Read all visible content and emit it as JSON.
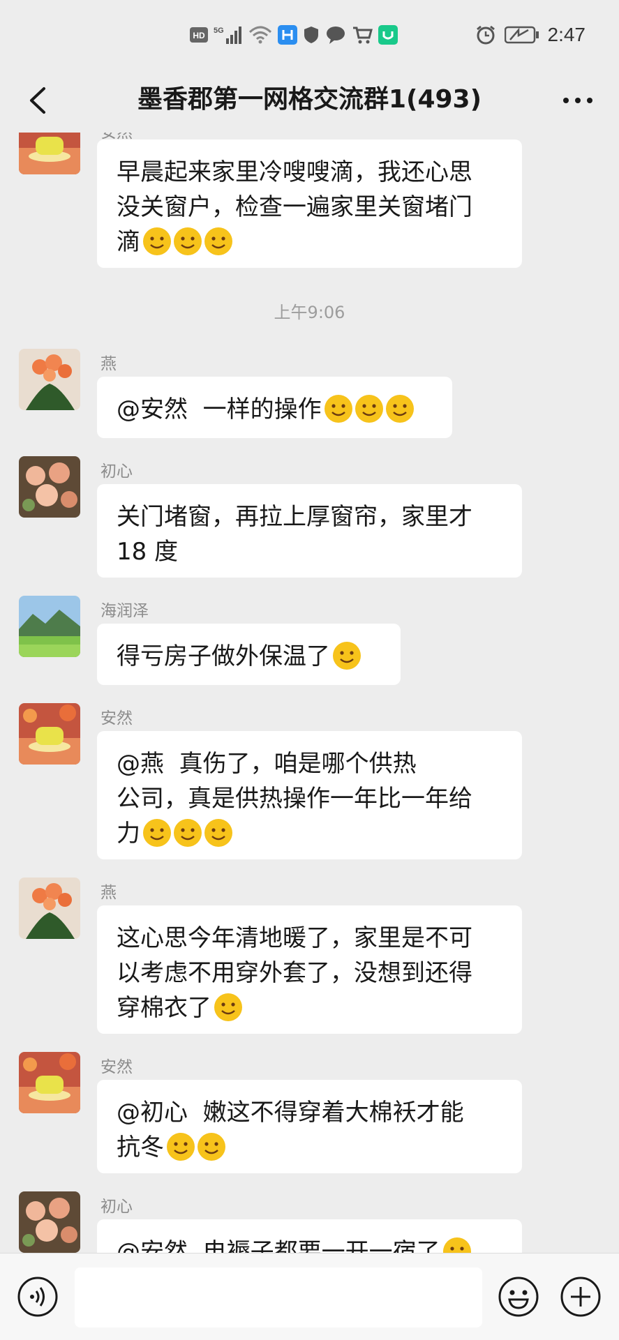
{
  "status_bar": {
    "time": "2:47",
    "icons": [
      "hd-icon",
      "signal-5g-icon",
      "wifi-icon",
      "app-icon",
      "shield-icon",
      "chat-icon",
      "cart-icon",
      "mi-icon"
    ],
    "right_icons": [
      "alarm-icon",
      "battery-icon"
    ]
  },
  "header": {
    "title": "墨香郡第一网格交流群1(493)"
  },
  "timestamp": "上午9:06",
  "messages": [
    {
      "sender": "安然",
      "text": "早晨起来家里冷嗖嗖滴，我还心思\n没关窗户，检查一遍家里关窗堵门\n滴",
      "avatar": "teacup"
    },
    {
      "sender": "燕",
      "text": "@安然  一样的操作",
      "avatar": "flower-orange"
    },
    {
      "sender": "初心",
      "text": "关门堵窗，再拉上厚窗帘，家里才\n18 度",
      "avatar": "flower-pink"
    },
    {
      "sender": "海润泽",
      "text": "得亏房子做外保温了",
      "avatar": "landscape"
    },
    {
      "sender": "安然",
      "text": "@燕  真伤了，咱是哪个供热\n公司，真是供热操作一年比一年给\n力",
      "avatar": "teacup"
    },
    {
      "sender": "燕",
      "text": "这心思今年清地暖了，家里是不可\n以考虑不用穿外套了，没想到还得\n穿棉衣了",
      "avatar": "flower-orange"
    },
    {
      "sender": "安然",
      "text": "@初心  嫩这不得穿着大棉袄才能\n抗冬",
      "avatar": "teacup"
    },
    {
      "sender": "初心",
      "text": "@安然  电褥子都要一开一宿了",
      "avatar": "flower-pink"
    }
  ],
  "input": {
    "placeholder": ""
  }
}
